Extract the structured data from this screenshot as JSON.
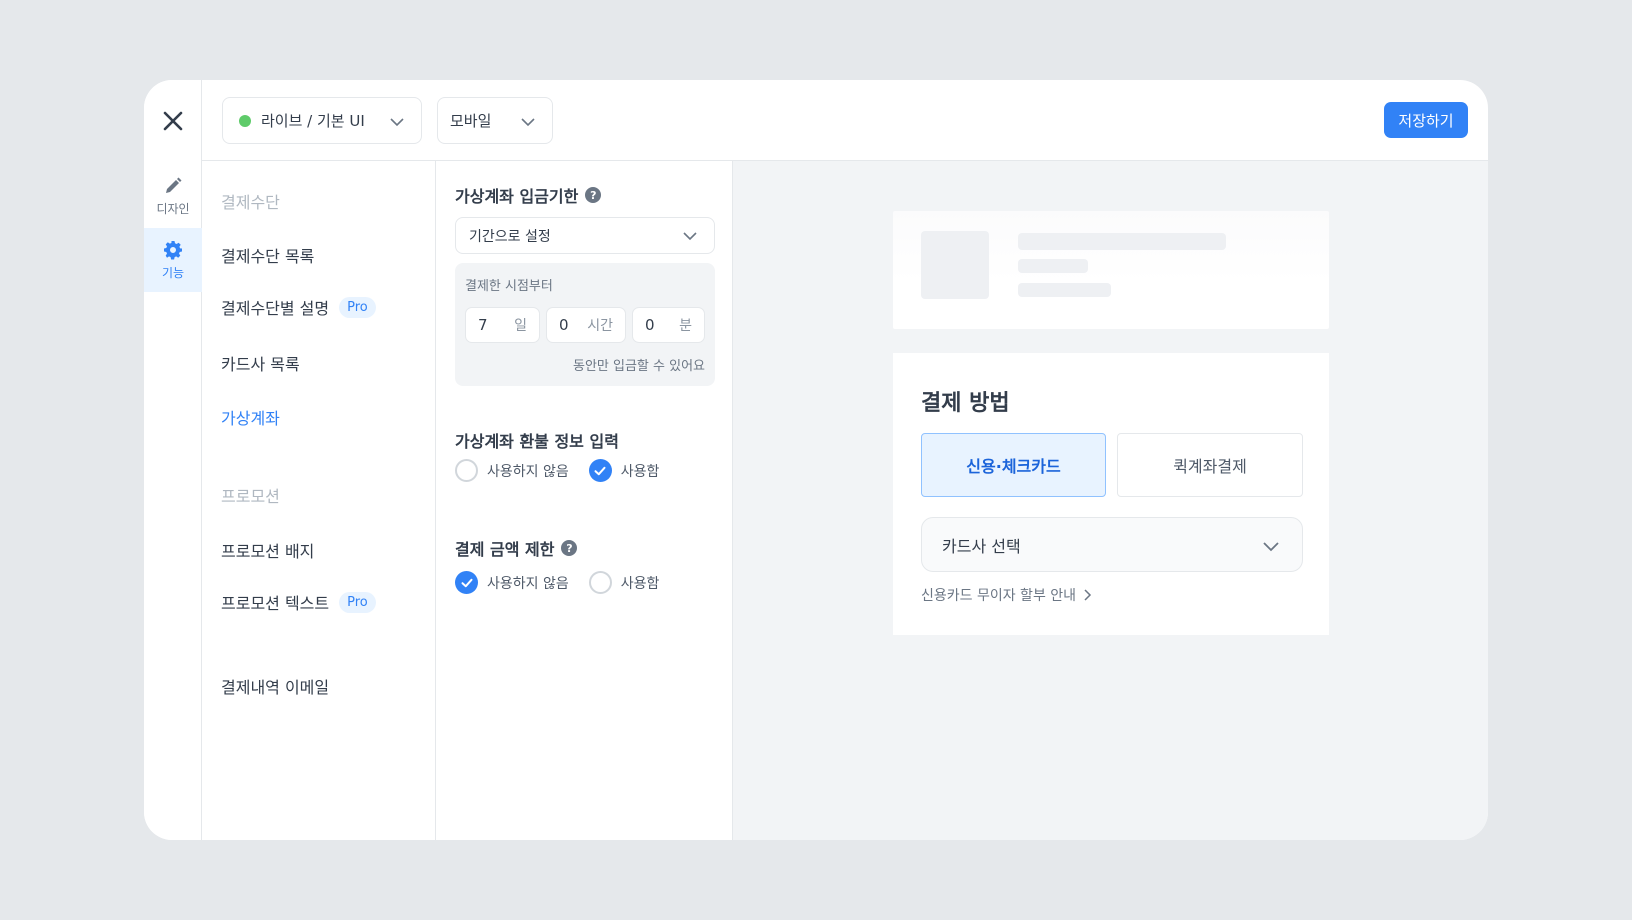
{
  "rail": {
    "design_label": "디자인",
    "feature_label": "기능"
  },
  "topbar": {
    "env_select": "라이브 / 기본 UI",
    "env_status_color": "#5fcb6a",
    "device_select": "모바일",
    "save_label": "저장하기"
  },
  "menu": {
    "section_payment": "결제수단",
    "items_payment": [
      "결제수단 목록",
      "결제수단별 설명",
      "카드사 목록",
      "가상계좌"
    ],
    "section_promo": "프로모션",
    "items_promo": [
      "프로모션 배지",
      "프로모션 텍스트"
    ],
    "email": "결제내역 이메일",
    "pro_badge": "Pro",
    "active_item": "가상계좌"
  },
  "settings": {
    "deadline": {
      "title": "가상계좌 입금기한",
      "select_value": "기간으로 설정",
      "caption": "결제한 시점부터",
      "days": "7",
      "days_unit": "일",
      "hours": "0",
      "hours_unit": "시간",
      "minutes": "0",
      "minutes_unit": "분",
      "note": "동안만 입금할 수 있어요"
    },
    "refund": {
      "title": "가상계좌 환불 정보 입력",
      "option_off": "사용하지 않음",
      "option_on": "사용함",
      "selected": "사용함"
    },
    "limit": {
      "title": "결제 금액 제한",
      "option_off": "사용하지 않음",
      "option_on": "사용함",
      "selected": "사용하지 않음"
    }
  },
  "preview": {
    "title": "결제 방법",
    "tab_card": "신용·체크카드",
    "tab_transfer": "퀵계좌결제",
    "card_select": "카드사 선택",
    "installment_link": "신용카드 무이자 할부 안내",
    "accent": "#3182f6"
  }
}
